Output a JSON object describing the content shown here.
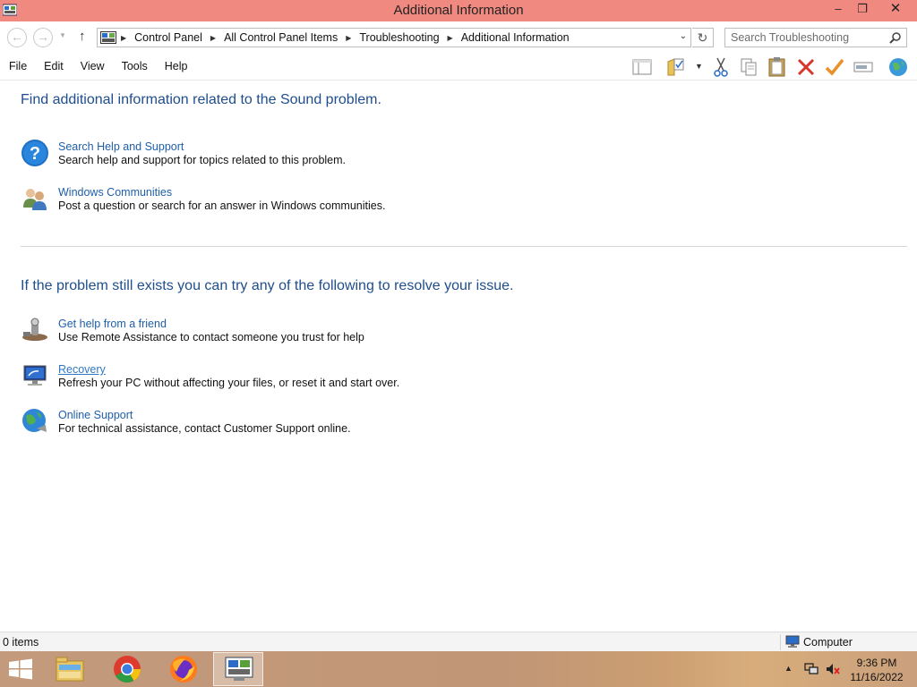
{
  "window": {
    "title": "Additional Information",
    "minimize_glyph": "–",
    "maximize_glyph": "❐",
    "close_glyph": "✕"
  },
  "address": {
    "breadcrumbs": [
      "Control Panel",
      "All Control Panel Items",
      "Troubleshooting",
      "Additional Information"
    ],
    "search_placeholder": "Search Troubleshooting"
  },
  "menu": {
    "items": [
      "File",
      "Edit",
      "View",
      "Tools",
      "Help"
    ]
  },
  "toolbar": {
    "icons": [
      "pane-icon",
      "folder-options-icon",
      "cut-icon",
      "copy-icon",
      "paste-icon",
      "delete-icon",
      "properties-check-icon",
      "rename-icon",
      "globe-icon"
    ]
  },
  "content": {
    "heading1": "Find additional information related to the Sound problem.",
    "heading2": "If the problem still exists you can try any of the following to resolve your issue.",
    "section1": [
      {
        "icon": "help-question-icon",
        "link": "Search Help and Support",
        "desc": "Search help and support for topics related to this problem."
      },
      {
        "icon": "communities-people-icon",
        "link": "Windows Communities",
        "desc": "Post a question or search for an answer in Windows communities."
      }
    ],
    "section2": [
      {
        "icon": "remote-assistance-icon",
        "link": "Get help from a friend",
        "desc": "Use Remote Assistance to contact someone you trust for help"
      },
      {
        "icon": "recovery-icon",
        "link": "Recovery",
        "desc": "Refresh your PC without affecting your files, or reset it and start over."
      },
      {
        "icon": "online-support-globe-icon",
        "link": "Online Support",
        "desc": "For technical assistance, contact Customer Support online."
      }
    ]
  },
  "status": {
    "items_count": "0 items",
    "location": "Computer"
  },
  "taskbar": {
    "apps": [
      "file-explorer-icon",
      "chrome-icon",
      "firefox-icon",
      "control-panel-icon"
    ],
    "time": "9:36 PM",
    "date": "11/16/2022"
  },
  "colors": {
    "titlebar": "#f08a80",
    "heading": "#1e4e8c",
    "link": "#1e5fa8"
  }
}
